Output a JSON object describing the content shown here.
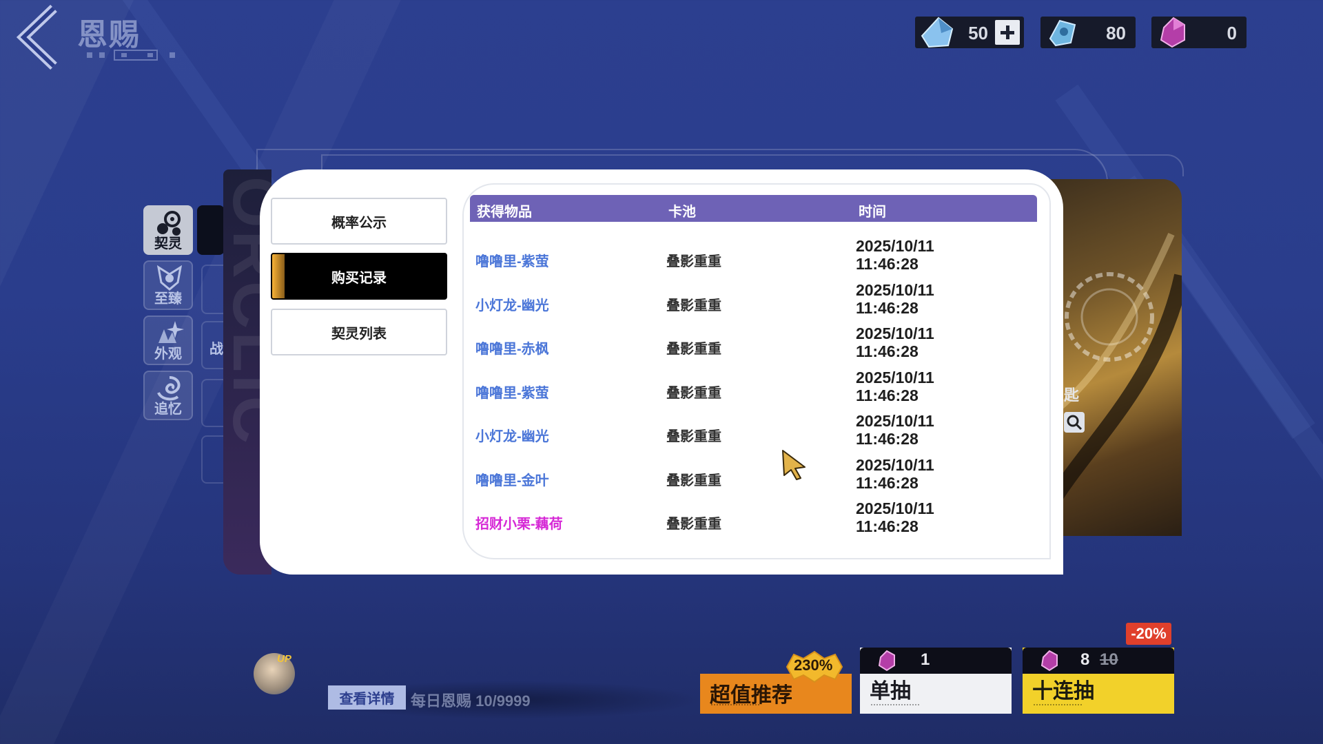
{
  "header": {
    "title": "恩赐"
  },
  "currencies": [
    {
      "name": "blue-crystal",
      "value": "50",
      "color": "#7ab7e8"
    },
    {
      "name": "cyan-ticket",
      "value": "80",
      "color": "#5fa8d8"
    },
    {
      "name": "purple-gem",
      "value": "0",
      "color": "#b43ea8"
    }
  ],
  "side_categories": [
    {
      "label": "契灵",
      "active": true,
      "icon": "contract-icon"
    },
    {
      "label": "至臻",
      "active": false,
      "icon": "crest-icon"
    },
    {
      "label": "外观",
      "active": false,
      "icon": "sparkle-icon"
    },
    {
      "label": "追忆",
      "active": false,
      "icon": "swirl-icon"
    }
  ],
  "background_fragments": {
    "tab_stub": "战",
    "card_label": "匙"
  },
  "menu": [
    {
      "label": "概率公示",
      "active": false
    },
    {
      "label": "购买记录",
      "active": true
    },
    {
      "label": "契灵列表",
      "active": false
    }
  ],
  "records": {
    "columns": [
      "获得物品",
      "卡池",
      "时间"
    ],
    "rows": [
      {
        "item": "噜噜里-紫萤",
        "pool": "叠影重重",
        "date": "2025/10/11",
        "time": "11:46:28",
        "rarity_color": "#4b76d8"
      },
      {
        "item": "小灯龙-幽光",
        "pool": "叠影重重",
        "date": "2025/10/11",
        "time": "11:46:28",
        "rarity_color": "#4b76d8"
      },
      {
        "item": "噜噜里-赤枫",
        "pool": "叠影重重",
        "date": "2025/10/11",
        "time": "11:46:28",
        "rarity_color": "#4b76d8"
      },
      {
        "item": "噜噜里-紫萤",
        "pool": "叠影重重",
        "date": "2025/10/11",
        "time": "11:46:28",
        "rarity_color": "#4b76d8"
      },
      {
        "item": "小灯龙-幽光",
        "pool": "叠影重重",
        "date": "2025/10/11",
        "time": "11:46:28",
        "rarity_color": "#4b76d8"
      },
      {
        "item": "噜噜里-金叶",
        "pool": "叠影重重",
        "date": "2025/10/11",
        "time": "11:46:28",
        "rarity_color": "#4b76d8"
      },
      {
        "item": "招财小栗-藕荷",
        "pool": "叠影重重",
        "date": "2025/10/11",
        "time": "11:46:28",
        "rarity_color": "#d629d6"
      }
    ]
  },
  "bottom": {
    "up_badge": "UP",
    "detail_button": "查看详情",
    "daily_text": "每日恩赐 10/9999",
    "promo": {
      "label": "超值推荐",
      "badge": "230%"
    },
    "single_draw": {
      "label": "单抽",
      "cost": "1"
    },
    "ten_draw": {
      "label": "十连抽",
      "cost": "8",
      "original_cost": "10",
      "discount": "-20%"
    }
  }
}
